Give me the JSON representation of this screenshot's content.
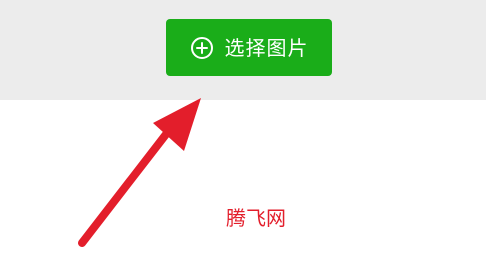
{
  "toolbar": {
    "select_button_label": "选择图片",
    "select_button_icon": "plus-circle-icon"
  },
  "annotation": {
    "arrow_icon": "red-arrow-icon",
    "watermark": "腾飞网"
  },
  "colors": {
    "background": "#ffffff",
    "panel_background": "#ececec",
    "button_green": "#1aad19",
    "annotation_red": "#e31e2b"
  }
}
